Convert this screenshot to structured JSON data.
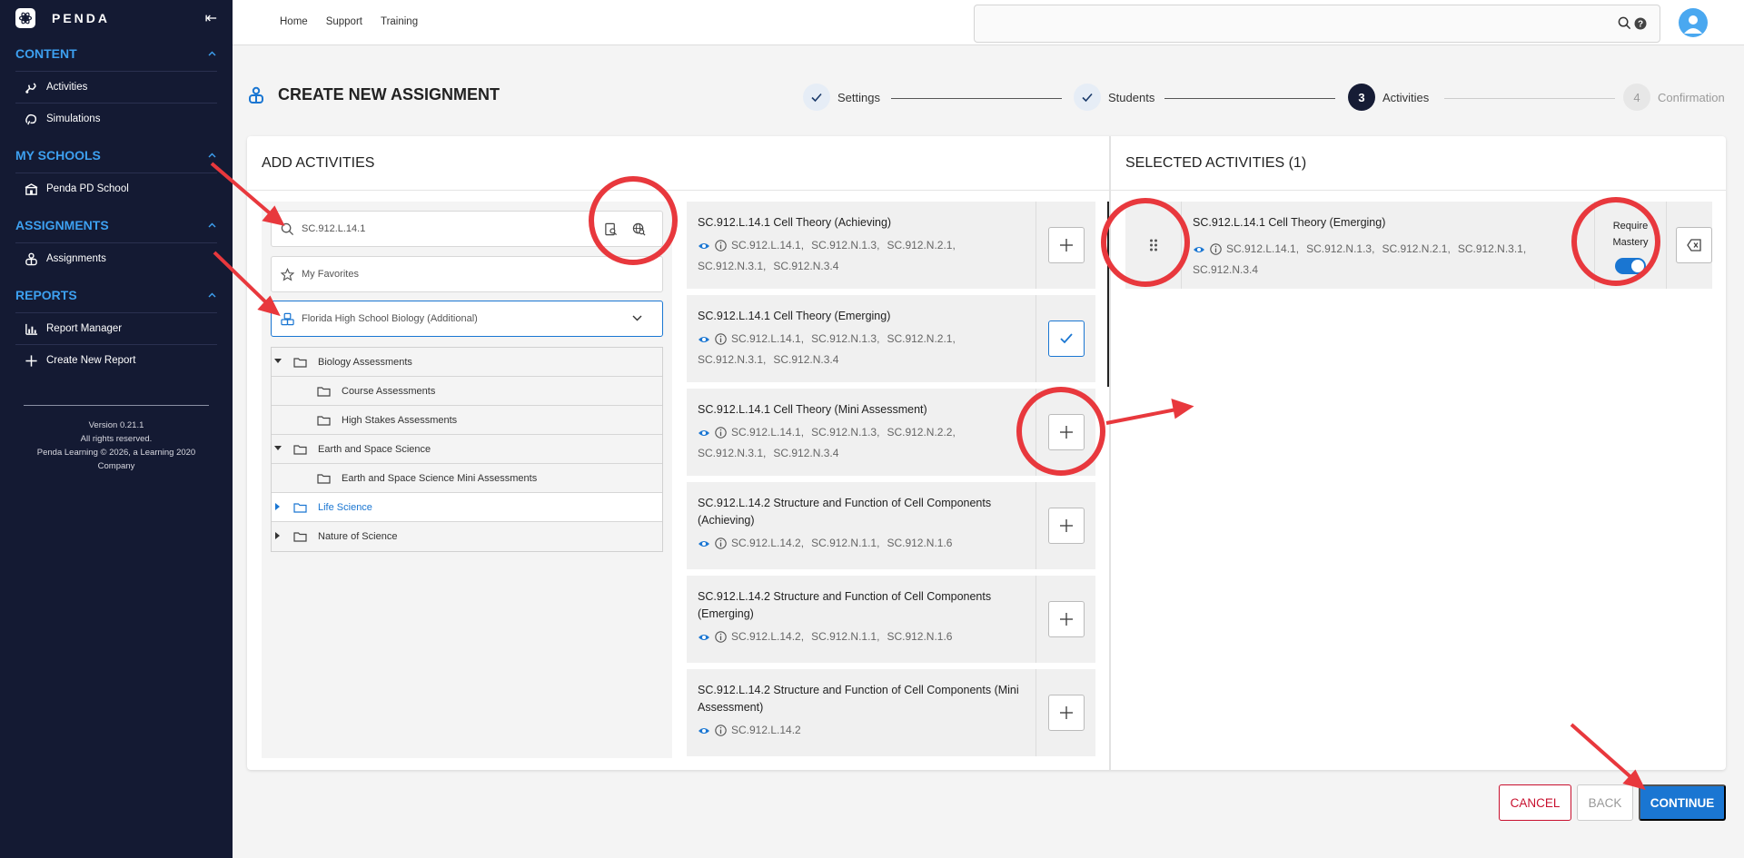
{
  "app": {
    "brand": "PENDA"
  },
  "sidebar": {
    "sections": [
      {
        "title": "CONTENT",
        "items": [
          {
            "label": "Activities",
            "icon": "activities-icon"
          },
          {
            "label": "Simulations",
            "icon": "simulations-icon"
          }
        ]
      },
      {
        "title": "MY SCHOOLS",
        "items": [
          {
            "label": "Penda PD School",
            "icon": "school-icon"
          }
        ]
      },
      {
        "title": "ASSIGNMENTS",
        "items": [
          {
            "label": "Assignments",
            "icon": "assignments-icon"
          }
        ]
      },
      {
        "title": "REPORTS",
        "items": [
          {
            "label": "Report Manager",
            "icon": "bar-chart-icon"
          },
          {
            "label": "Create New Report",
            "icon": "plus-icon"
          }
        ]
      }
    ],
    "footer": {
      "version": "Version 0.21.1",
      "rights": "All rights reserved.",
      "copyright": "Penda Learning © 2026, a Learning 2020 Company"
    }
  },
  "topbar": {
    "links": [
      "Home",
      "Support",
      "Training"
    ],
    "search_placeholder": ""
  },
  "page": {
    "title": "CREATE NEW ASSIGNMENT"
  },
  "steps": [
    {
      "label": "Settings",
      "state": "done",
      "num": ""
    },
    {
      "label": "Students",
      "state": "done",
      "num": ""
    },
    {
      "label": "Activities",
      "state": "active",
      "num": "3"
    },
    {
      "label": "Confirmation",
      "state": "todo",
      "num": "4"
    }
  ],
  "add_panel": {
    "title": "ADD ACTIVITIES",
    "search_value": "SC.912.L.14.1",
    "favorites_label": "My Favorites",
    "course_select": "Florida High School Biology (Additional)",
    "tree": [
      {
        "label": "Biology Assessments",
        "level": 0,
        "toggle": "down",
        "selected": false
      },
      {
        "label": "Course Assessments",
        "level": 1,
        "toggle": "",
        "selected": false
      },
      {
        "label": "High Stakes Assessments",
        "level": 1,
        "toggle": "",
        "selected": false
      },
      {
        "label": "Earth and Space Science",
        "level": 0,
        "toggle": "down",
        "selected": false
      },
      {
        "label": "Earth and Space Science Mini Assessments",
        "level": 1,
        "toggle": "",
        "selected": false
      },
      {
        "label": "Life Science",
        "level": 0,
        "toggle": "right",
        "selected": true
      },
      {
        "label": "Nature of Science",
        "level": 0,
        "toggle": "right",
        "selected": false
      }
    ],
    "activities": [
      {
        "title": "SC.912.L.14.1 Cell Theory (Achieving)",
        "tags": [
          "SC.912.L.14.1,",
          "SC.912.N.1.3,",
          "SC.912.N.2.1,",
          "SC.912.N.3.1,",
          "SC.912.N.3.4"
        ],
        "added": false
      },
      {
        "title": "SC.912.L.14.1 Cell Theory (Emerging)",
        "tags": [
          "SC.912.L.14.1,",
          "SC.912.N.1.3,",
          "SC.912.N.2.1,",
          "SC.912.N.3.1,",
          "SC.912.N.3.4"
        ],
        "added": true
      },
      {
        "title": "SC.912.L.14.1 Cell Theory (Mini Assessment)",
        "tags": [
          "SC.912.L.14.1,",
          "SC.912.N.1.3,",
          "SC.912.N.2.2,",
          "SC.912.N.3.1,",
          "SC.912.N.3.4"
        ],
        "added": false
      },
      {
        "title": "SC.912.L.14.2 Structure and Function of Cell Components (Achieving)",
        "tags": [
          "SC.912.L.14.2,",
          "SC.912.N.1.1,",
          "SC.912.N.1.6"
        ],
        "added": false
      },
      {
        "title": "SC.912.L.14.2 Structure and Function of Cell Components (Emerging)",
        "tags": [
          "SC.912.L.14.2,",
          "SC.912.N.1.1,",
          "SC.912.N.1.6"
        ],
        "added": false
      },
      {
        "title": "SC.912.L.14.2 Structure and Function of Cell Components (Mini Assessment)",
        "tags": [
          "SC.912.L.14.2"
        ],
        "added": false
      }
    ]
  },
  "selected_panel": {
    "title": "SELECTED ACTIVITIES (1)",
    "items": [
      {
        "title": "SC.912.L.14.1 Cell Theory (Emerging)",
        "tags": [
          "SC.912.L.14.1,",
          "SC.912.N.1.3,",
          "SC.912.N.2.1,",
          "SC.912.N.3.1,",
          "SC.912.N.3.4"
        ],
        "mastery_label": "Require Mastery",
        "mastery_on": true
      }
    ]
  },
  "footer_buttons": {
    "cancel": "CANCEL",
    "back": "BACK",
    "continue": "CONTINUE"
  },
  "colors": {
    "sidebar_bg": "#141a33",
    "accent": "#1a76d2",
    "section_head": "#3da0f0",
    "cancel": "#c8102e",
    "annotation": "#e8383d"
  }
}
